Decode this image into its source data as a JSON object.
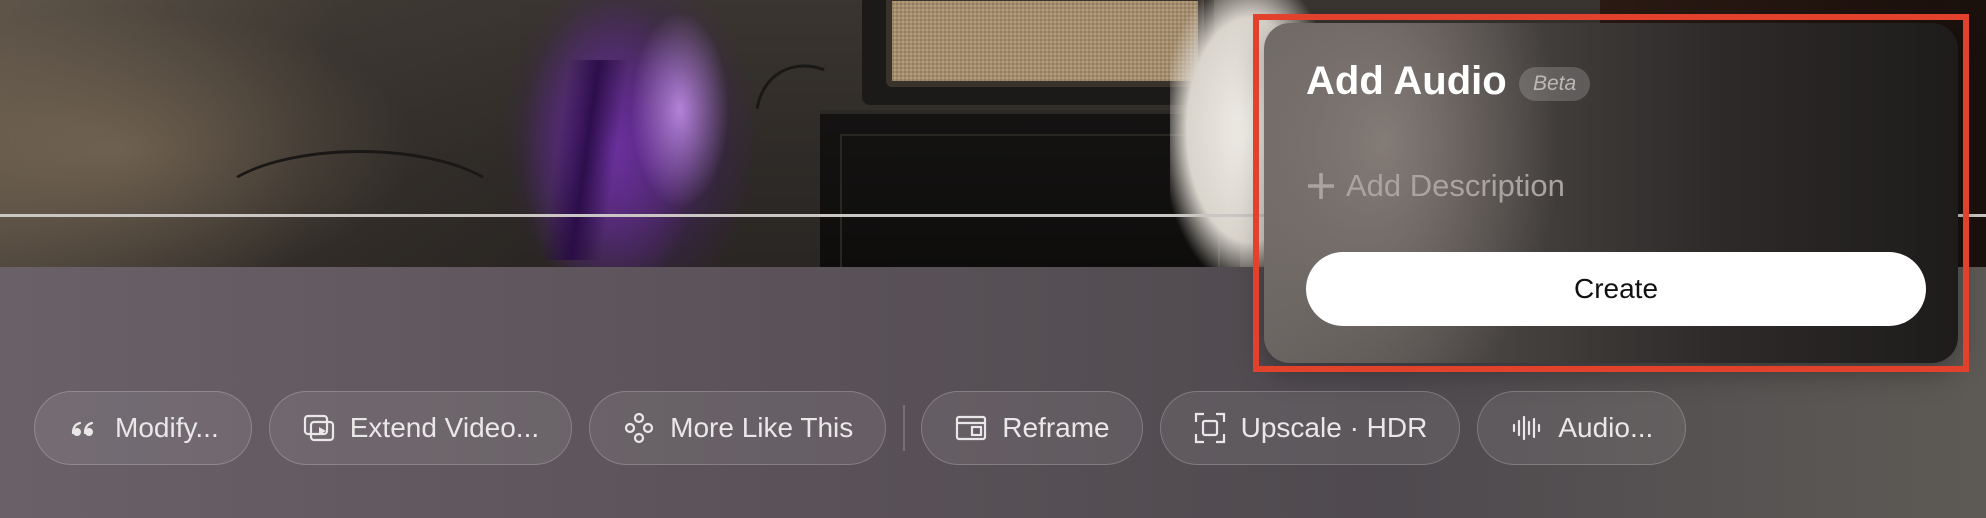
{
  "panel": {
    "title": "Add Audio",
    "badge": "Beta",
    "add_description_label": "Add Description",
    "create_label": "Create"
  },
  "toolbar": {
    "items": [
      {
        "label": "Modify...",
        "icon": "quote-icon"
      },
      {
        "label": "Extend Video...",
        "icon": "extend-video-icon"
      },
      {
        "label": "More Like This",
        "icon": "nodes-icon"
      },
      {
        "label": "Reframe",
        "icon": "reframe-icon"
      },
      {
        "label": "Upscale · HDR",
        "icon": "upscale-icon"
      },
      {
        "label": "Audio...",
        "icon": "waveform-icon"
      }
    ]
  },
  "colors": {
    "highlight": "#e2412c",
    "create_button_bg": "#ffffff"
  }
}
